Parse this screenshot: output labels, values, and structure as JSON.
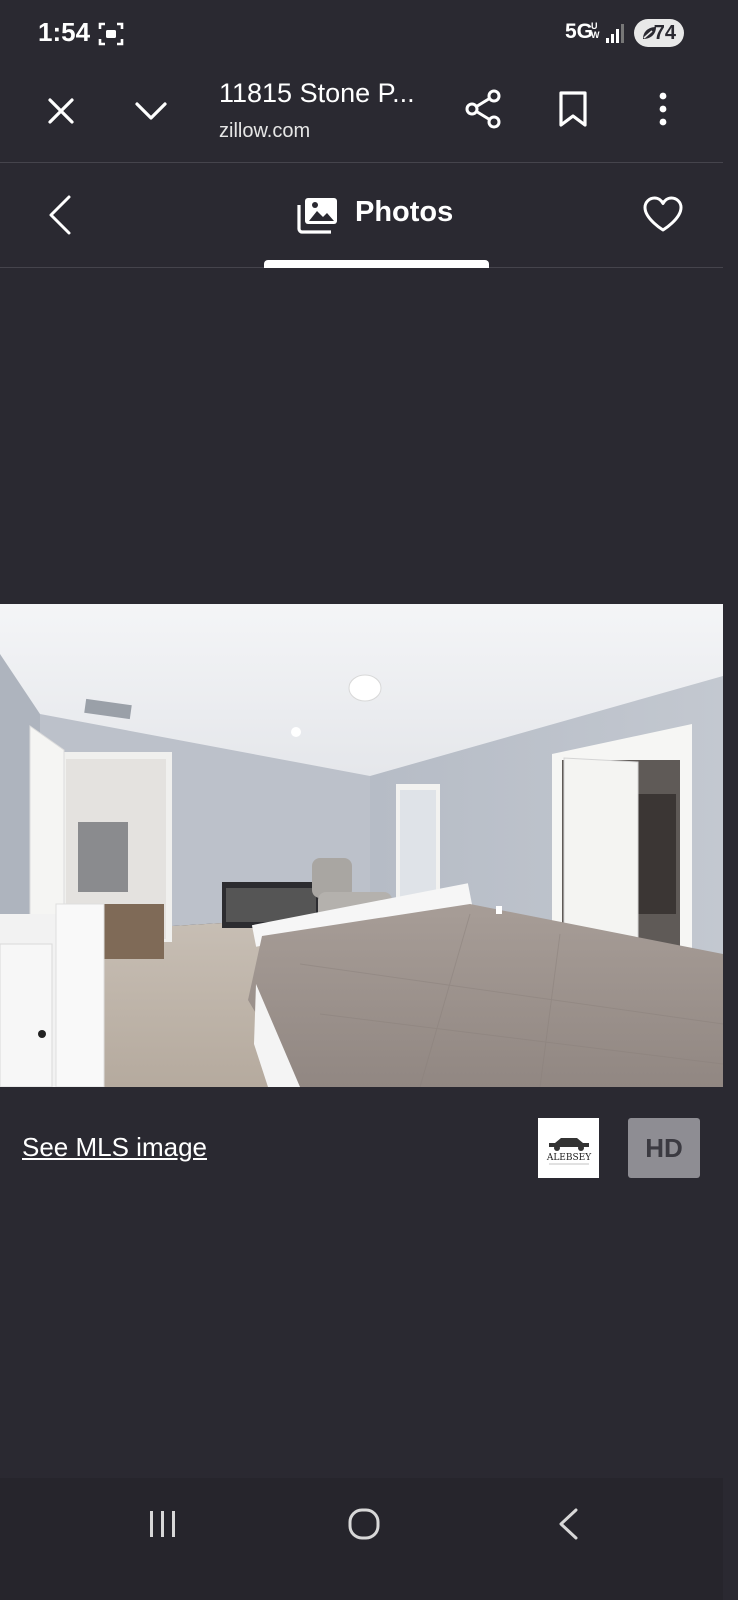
{
  "status_bar": {
    "time": "1:54",
    "network": "5G",
    "network_sub": "U\nW",
    "battery": "74"
  },
  "browser": {
    "page_title": "11815 Stone P...",
    "url": "zillow.com"
  },
  "photos_header": {
    "label": "Photos"
  },
  "photo": {
    "description_icon": "bedroom-photo"
  },
  "footer": {
    "mls_link": "See MLS image",
    "brand_logo_text": "ALEBSEY",
    "hd_label": "HD"
  },
  "colors": {
    "background": "#2a2931",
    "text": "#ffffff",
    "hd_button": "#8e8d93"
  }
}
